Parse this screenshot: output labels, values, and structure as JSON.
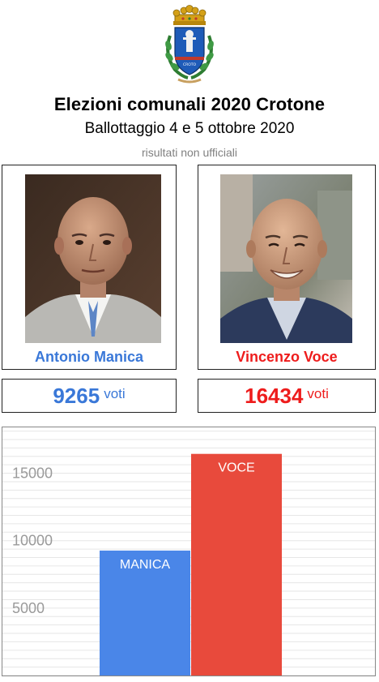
{
  "header": {
    "title": "Elezioni comunali 2020 Crotone",
    "subtitle": "Ballottaggio 4 e 5 ottobre 2020",
    "note": "risultati non ufficiali"
  },
  "crest": {
    "ribbon_text": "CROTO"
  },
  "candidates": [
    {
      "name": "Antonio Manica",
      "votes": "9265",
      "votes_label": "voti",
      "color": "#3a78d8"
    },
    {
      "name": "Vincenzo Voce",
      "votes": "16434",
      "votes_label": "voti",
      "color": "#ee1c1c"
    }
  ],
  "chart_data": {
    "type": "bar",
    "categories": [
      "MANICA",
      "VOCE"
    ],
    "values": [
      9265,
      16434
    ],
    "colors": [
      "#4a86e8",
      "#e84a3c"
    ],
    "yticks": [
      5000,
      10000,
      15000
    ],
    "ylim": [
      0,
      18400
    ],
    "grid": true,
    "data_labels": [
      "MANICA",
      "VOCE"
    ]
  }
}
